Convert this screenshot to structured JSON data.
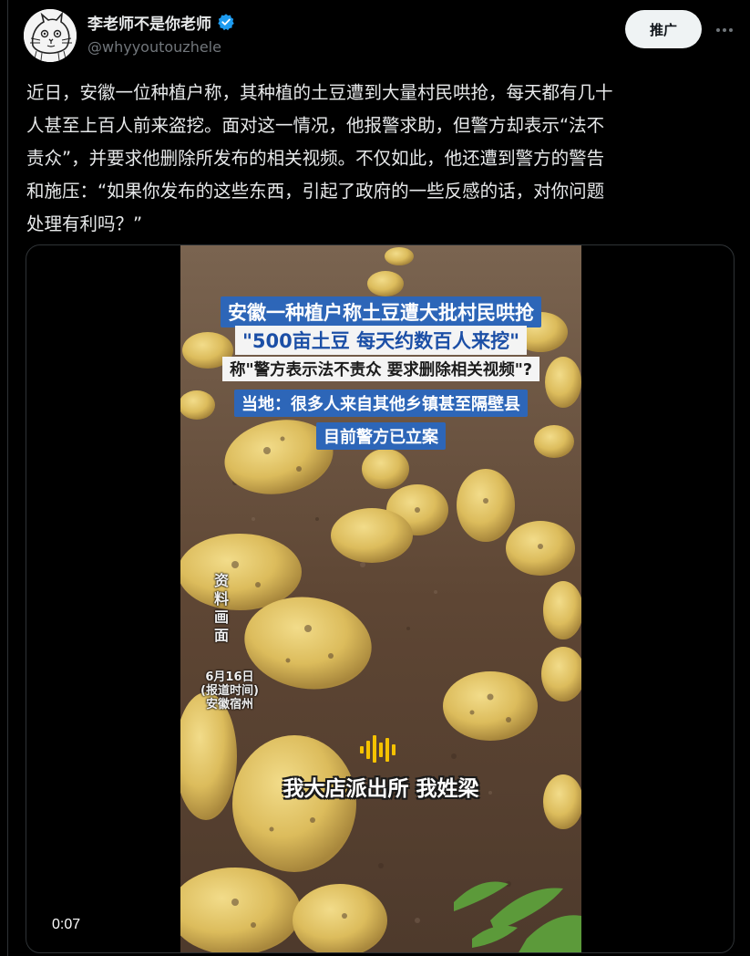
{
  "author": {
    "display_name": "李老师不是你老师",
    "handle": "@whyyoutouzhele",
    "verified": true,
    "avatar_icon": "cat-sketch-avatar"
  },
  "actions": {
    "promote_label": "推广",
    "more_icon": "more-horizontal-icon"
  },
  "tweet": {
    "lines": [
      "近日，安徽一位种植户称，其种植的土豆遭到大量村民哄抢，每天都有几十",
      "人甚至上百人前来盗挖。面对这一情况，他报警求助，但警方却表示“法不",
      "责众”，并要求他删除所发布的相关视频。不仅如此，他还遭到警方的警告",
      "和施压：“如果你发布的这些东西，引起了政府的一些反感的话，对你问题",
      "处理有利吗？”"
    ]
  },
  "video": {
    "captions": [
      "安徽一种植户称土豆遭大批村民哄抢",
      "\"500亩土豆 每天约数百人来挖\"",
      "称\"警方表示法不责众 要求删除相关视频\"?",
      "当地：很多人来自其他乡镇甚至隔壁县",
      "目前警方已立案"
    ],
    "side_label": "资料画面",
    "report_info": {
      "date": "6月16日",
      "note": "(报道时间)",
      "location": "安徽宿州"
    },
    "subtitle": "我大店派出所 我姓梁",
    "timestamp": "0:07",
    "colors": {
      "caption_blue": "#2d66b8",
      "caption_text_blue": "#1c4fa6",
      "soil": "#6a5340",
      "potato": "#e2c46a"
    }
  },
  "colors": {
    "background": "#000000",
    "text_primary": "#e7e9ea",
    "text_secondary": "#71767b",
    "verified_blue": "#1d9bf0",
    "button_bg": "#eff3f4"
  }
}
